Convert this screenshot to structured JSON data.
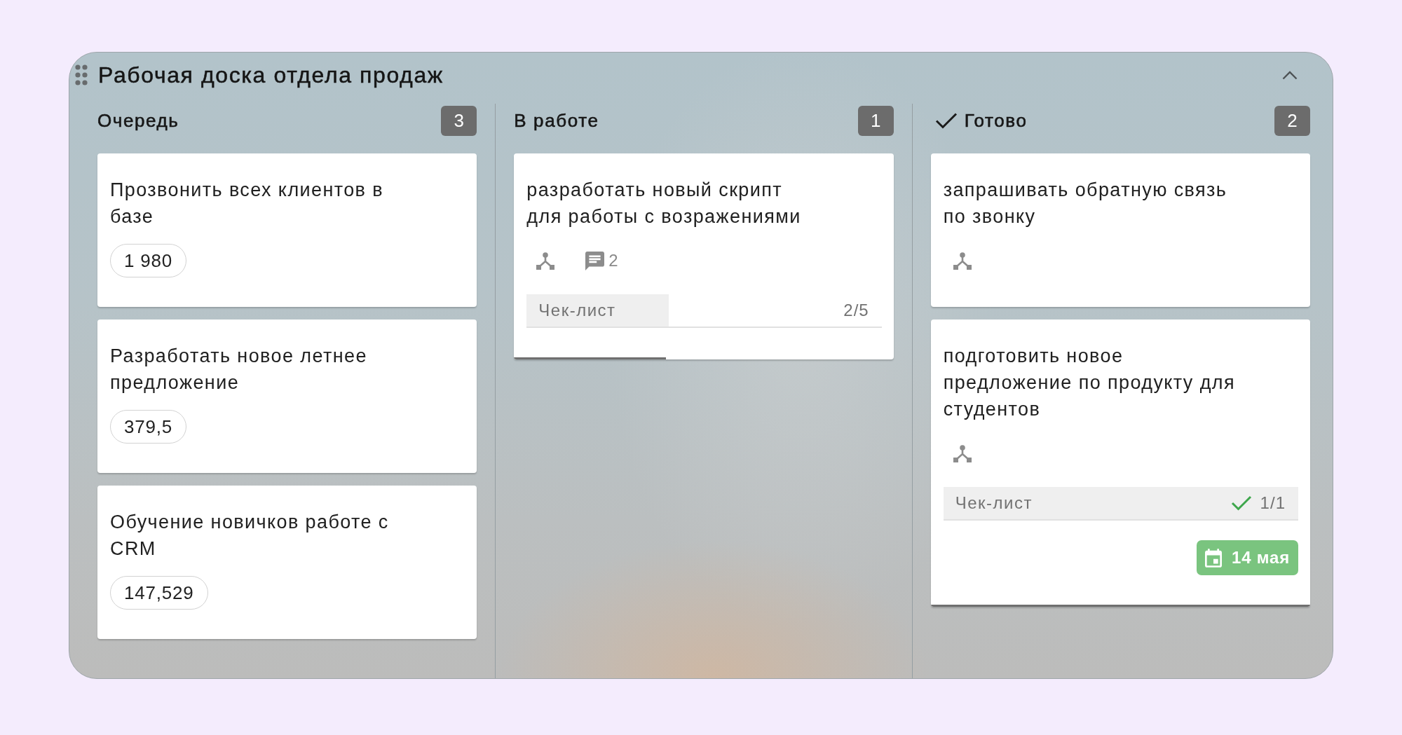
{
  "board": {
    "title": "Рабочая доска отдела продаж",
    "expanded": true
  },
  "columns": [
    {
      "title": "Очередь",
      "count": "3",
      "done": false,
      "cards": [
        {
          "title": "Прозвонить всех клиентов в базе",
          "amount": "1 980",
          "linked": false
        },
        {
          "title": "Разработать новое летнее предложение",
          "amount": "379,5",
          "linked": false
        },
        {
          "title": "Обучение новичков работе с CRM",
          "amount": "147,529",
          "linked": false
        }
      ]
    },
    {
      "title": "В работе",
      "count": "1",
      "done": false,
      "cards": [
        {
          "title": "разработать новый скрипт для работы с возражениями",
          "linked": true,
          "comments": "2",
          "checklist": {
            "label": "Чек-лист",
            "progress": "2/5",
            "level": 0.4,
            "complete": false
          }
        }
      ]
    },
    {
      "title": "Готово",
      "count": "2",
      "done": true,
      "cards": [
        {
          "title": "запрашивать обратную связь по звонку",
          "linked": true
        },
        {
          "title": "подготовить новое предложение по продукту для студентов",
          "linked": true,
          "checklist": {
            "label": "Чек-лист",
            "progress": "1/1",
            "level": 1,
            "complete": true
          },
          "due_date": "14 мая"
        }
      ]
    }
  ]
}
